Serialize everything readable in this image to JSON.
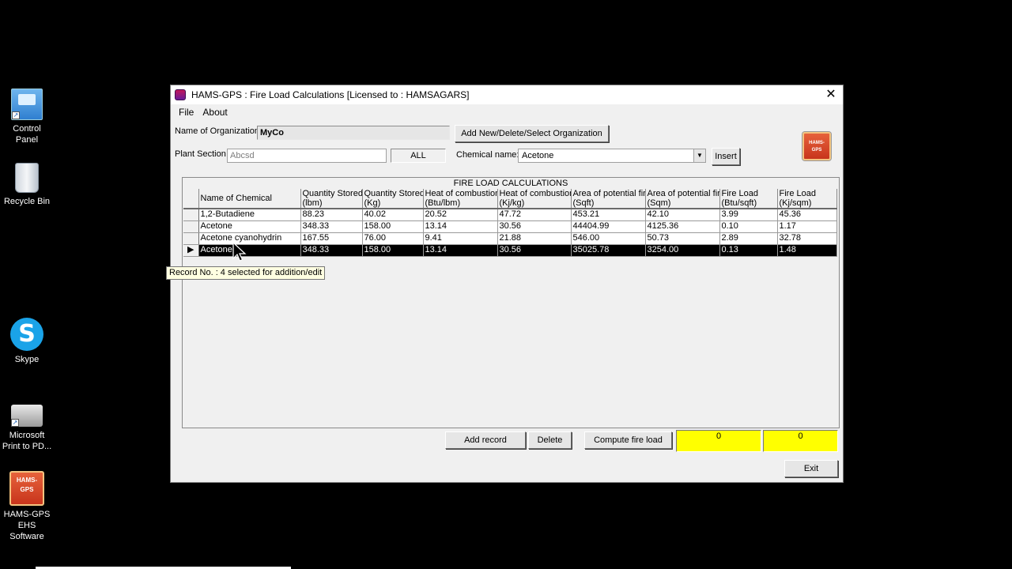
{
  "desktop": {
    "icons": [
      {
        "label": "Control Panel",
        "icon": "control-panel-icon"
      },
      {
        "label": "Recycle Bin",
        "icon": "recycle-bin-icon"
      },
      {
        "label": "Skype",
        "icon": "skype-icon"
      },
      {
        "label": "Microsoft Print to PD...",
        "icon": "printer-icon"
      },
      {
        "label": "HAMS-GPS EHS Software",
        "icon": "hams-gps-icon"
      }
    ],
    "skype_glyph": "S",
    "hams_logo_text": "HAMS-GPS"
  },
  "window": {
    "title": "HAMS-GPS : Fire Load Calculations [Licensed to : HAMSAGARS]",
    "close_glyph": "✕",
    "menu": [
      "File",
      "About"
    ]
  },
  "form": {
    "org_label": "Name of Organization:",
    "org_value": "MyCo",
    "org_button": "Add New/Delete/Select Organization",
    "plant_label": "Plant Section",
    "plant_value": "Abcsd",
    "all_label": "ALL",
    "chemical_label": "Chemical name:",
    "chemical_value": "Acetone",
    "insert_button": "Insert"
  },
  "grid": {
    "caption": "FIRE LOAD CALCULATIONS",
    "columns": [
      "Name of Chemical",
      "Quantity Stored (lbm)",
      "Quantity Stored (Kg)",
      "Heat of combustion (Btu/lbm)",
      "Heat of combustion (Kj/kg)",
      "Area of potential fire (Sqft)",
      "Area of potential fire (Sqm)",
      "Fire Load (Btu/sqft)",
      "Fire Load (Kj/sqm)"
    ],
    "columns_line1": [
      "Name of Chemical",
      "Quantity Stored",
      "Quantity Stored",
      "Heat of combustion",
      "Heat of combustion",
      "Area of potential fire",
      "Area of potential fire",
      "Fire Load",
      "Fire Load"
    ],
    "columns_line2": [
      "",
      "(lbm)",
      "(Kg)",
      "(Btu/lbm)",
      "(Kj/kg)",
      "(Sqft)",
      "(Sqm)",
      "(Btu/sqft)",
      "(Kj/sqm)"
    ],
    "rows": [
      [
        "1,2-Butadiene",
        "88.23",
        "40.02",
        "20.52",
        "47.72",
        "453.21",
        "42.10",
        "3.99",
        "45.36"
      ],
      [
        "Acetone",
        "348.33",
        "158.00",
        "13.14",
        "30.56",
        "44404.99",
        "4125.36",
        "0.10",
        "1.17"
      ],
      [
        "Acetone cyanohydrin",
        "167.55",
        "76.00",
        "9.41",
        "21.88",
        "546.00",
        "50.73",
        "2.89",
        "32.78"
      ],
      [
        "Acetone",
        "348.33",
        "158.00",
        "13.14",
        "30.56",
        "35025.78",
        "3254.00",
        "0.13",
        "1.48"
      ]
    ],
    "selected_row": 3,
    "row_pointer_glyph": "▶"
  },
  "tooltip": "Record No. : 4 selected for addition/edit",
  "footer": {
    "add_record": "Add record",
    "delete": "Delete",
    "compute": "Compute fire load",
    "result1": "0",
    "result2": "0",
    "exit": "Exit"
  },
  "colors": {
    "highlight": "#ffff00",
    "selected_row_bg": "#000000"
  }
}
